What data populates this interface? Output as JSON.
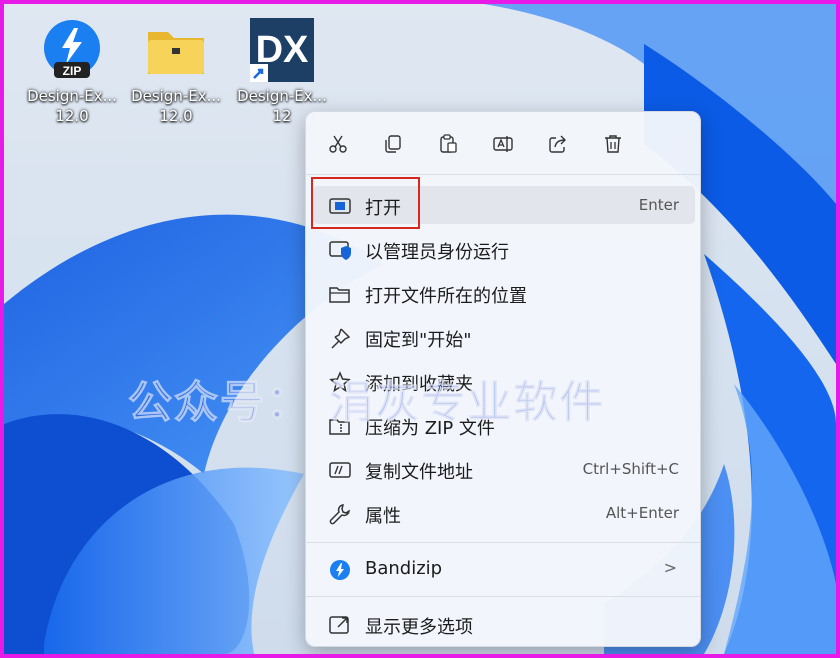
{
  "desktop": {
    "icons": [
      {
        "name": "Design-Ex...",
        "version": "12.0"
      },
      {
        "name": "Design-Ex...",
        "version": "12.0"
      },
      {
        "name": "Design-Ex...",
        "version": "12"
      }
    ],
    "zip_badge": "ZIP",
    "dx_logo": "DX"
  },
  "context_menu": {
    "toolbar": [
      "cut-icon",
      "copy-icon",
      "paste-icon",
      "rename-icon",
      "share-icon",
      "delete-icon"
    ],
    "items": [
      {
        "label": "打开",
        "shortcut": "Enter",
        "icon": "open-icon"
      },
      {
        "label": "以管理员身份运行",
        "icon": "shield-icon"
      },
      {
        "label": "打开文件所在的位置",
        "icon": "folder-icon"
      },
      {
        "label": "固定到\"开始\"",
        "icon": "pin-icon"
      },
      {
        "label": "添加到收藏夹",
        "icon": "star-icon"
      },
      {
        "label": "压缩为 ZIP 文件",
        "icon": "zip-folder-icon"
      },
      {
        "label": "复制文件地址",
        "shortcut": "Ctrl+Shift+C",
        "icon": "copy-path-icon"
      },
      {
        "label": "属性",
        "shortcut": "Alt+Enter",
        "icon": "wrench-icon"
      },
      {
        "label": "Bandizip",
        "icon": "bandizip-icon",
        "submenu": ">"
      },
      {
        "label": "显示更多选项",
        "icon": "more-options-icon"
      }
    ]
  },
  "watermark": "公众号：  涓灰专业软件",
  "colors": {
    "highlight_border": "#d6281e",
    "frame": "#e81ae8",
    "accent": "#1565d8"
  }
}
